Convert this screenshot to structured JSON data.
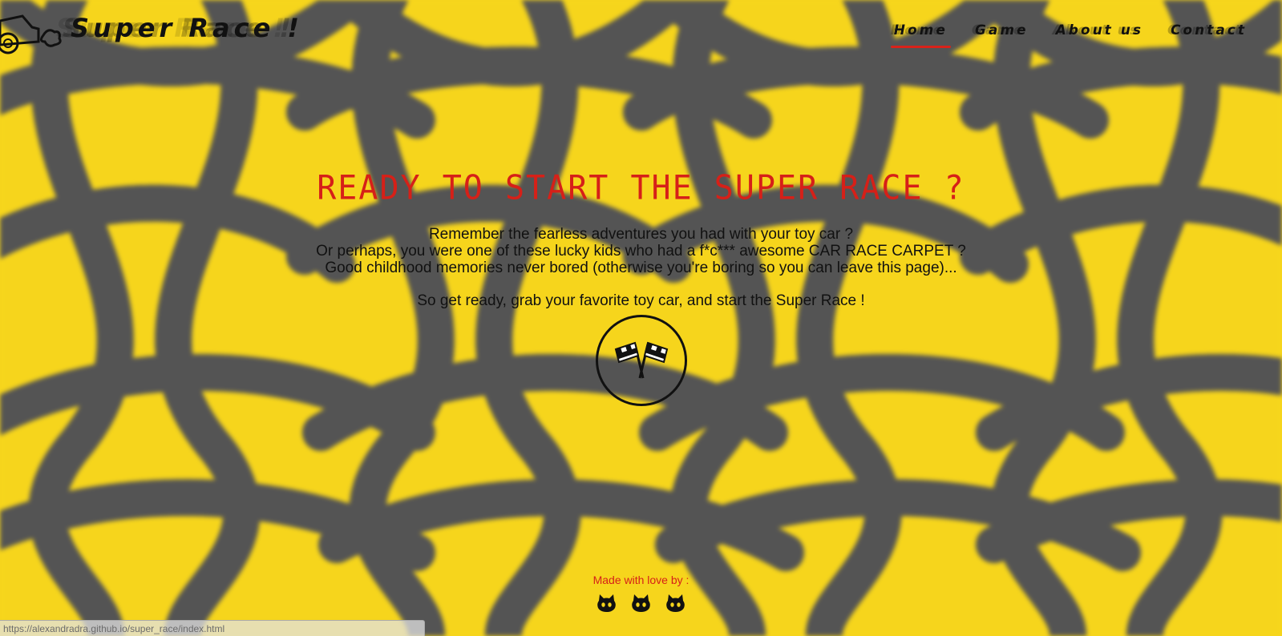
{
  "brand": {
    "title": "Super Race !",
    "logo_icon": "race-car-icon"
  },
  "nav": {
    "items": [
      {
        "label": "Home",
        "active": true
      },
      {
        "label": "Game",
        "active": false
      },
      {
        "label": "About us",
        "active": false
      },
      {
        "label": "Contact",
        "active": false
      }
    ]
  },
  "hero": {
    "title": "READY TO START THE SUPER RACE ?",
    "lines": [
      "Remember the fearless adventures you had with your toy car ?",
      "Or perhaps, you were one of these lucky kids who had a f*c*** awesome CAR RACE CARPET ?",
      "Good childhood memories never bored (otherwise you're boring so you can leave this page)..."
    ],
    "cta_text": "So get ready, grab your favorite toy car, and start the Super Race !",
    "start_icon": "checkered-flags-icon"
  },
  "footer": {
    "made_with": "Made with love by :",
    "author_links": [
      {
        "icon": "github-icon"
      },
      {
        "icon": "github-icon"
      },
      {
        "icon": "github-icon"
      }
    ]
  },
  "status_bar": {
    "url": "https://alexandradra.github.io/super_race/index.html"
  },
  "colors": {
    "background": "#f6d51c",
    "track": "#555555",
    "accent_red": "#d62018",
    "text": "#111111"
  }
}
